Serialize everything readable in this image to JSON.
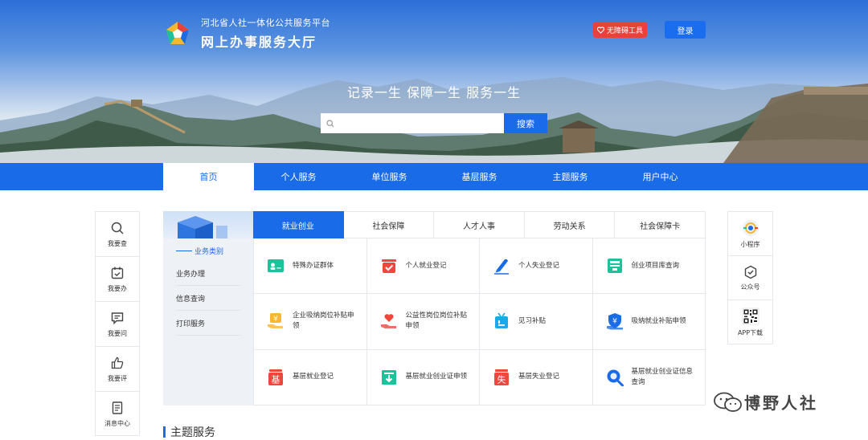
{
  "header": {
    "org_line": "河北省人社一体化公共服务平台",
    "site_title": "网上办事服务大厅",
    "accessibility_label": "无障碍工具",
    "login_label": "登录"
  },
  "hero": {
    "slogan": "记录一生 保障一生 服务一生",
    "search_placeholder": "",
    "search_button": "搜索"
  },
  "nav": {
    "items": [
      "首页",
      "个人服务",
      "单位服务",
      "基层服务",
      "主题服务",
      "用户中心"
    ]
  },
  "left_float": {
    "items": [
      {
        "label": "我要查",
        "icon": "search-icon"
      },
      {
        "label": "我要办",
        "icon": "calendar-check-icon"
      },
      {
        "label": "我要问",
        "icon": "chat-icon"
      },
      {
        "label": "我要评",
        "icon": "thumbs-up-icon"
      },
      {
        "label": "消息中心",
        "icon": "document-icon"
      }
    ]
  },
  "right_float": {
    "items": [
      {
        "label": "小程序",
        "icon": "miniprogram-icon"
      },
      {
        "label": "公众号",
        "icon": "official-account-icon"
      },
      {
        "label": "APP下载",
        "icon": "qrcode-icon"
      }
    ]
  },
  "side_panel": {
    "category_title": "业务类别",
    "menu": [
      "业务办理",
      "信息查询",
      "打印服务"
    ]
  },
  "tabs": [
    "就业创业",
    "社会保障",
    "人才人事",
    "劳动关系",
    "社会保障卡"
  ],
  "services": [
    {
      "label": "特殊办证群体",
      "icon": "id-card-icon",
      "color": "#1cc29a"
    },
    {
      "label": "个人就业登记",
      "icon": "inbox-check-icon",
      "color": "#f0473d"
    },
    {
      "label": "个人失业登记",
      "icon": "pen-icon",
      "color": "#1a6be8"
    },
    {
      "label": "创业项目库查询",
      "icon": "archive-icon",
      "color": "#1cc29a"
    },
    {
      "label": "企业吸纳岗位补贴申领",
      "icon": "yen-hand-icon",
      "color": "#f7b731"
    },
    {
      "label": "公益性岗位岗位补贴申领",
      "icon": "heart-hand-icon",
      "color": "#f0473d"
    },
    {
      "label": "见习补贴",
      "icon": "tv-icon",
      "color": "#19a8e8"
    },
    {
      "label": "吸纳就业补贴申领",
      "icon": "shield-yen-icon",
      "color": "#1a6be8"
    },
    {
      "label": "基层就业登记",
      "icon": "ji-badge-icon",
      "color": "#f0473d"
    },
    {
      "label": "基层就业创业证申领",
      "icon": "download-box-icon",
      "color": "#1cc29a"
    },
    {
      "label": "基层失业登记",
      "icon": "shi-badge-icon",
      "color": "#f0473d"
    },
    {
      "label": "基层就业创业证信息查询",
      "icon": "magnifier-icon",
      "color": "#1a6be8"
    }
  ],
  "section": {
    "title": "主题服务"
  },
  "watermark": {
    "text": "博野人社"
  },
  "colors": {
    "primary": "#1a6be8",
    "danger": "#e8423b"
  }
}
